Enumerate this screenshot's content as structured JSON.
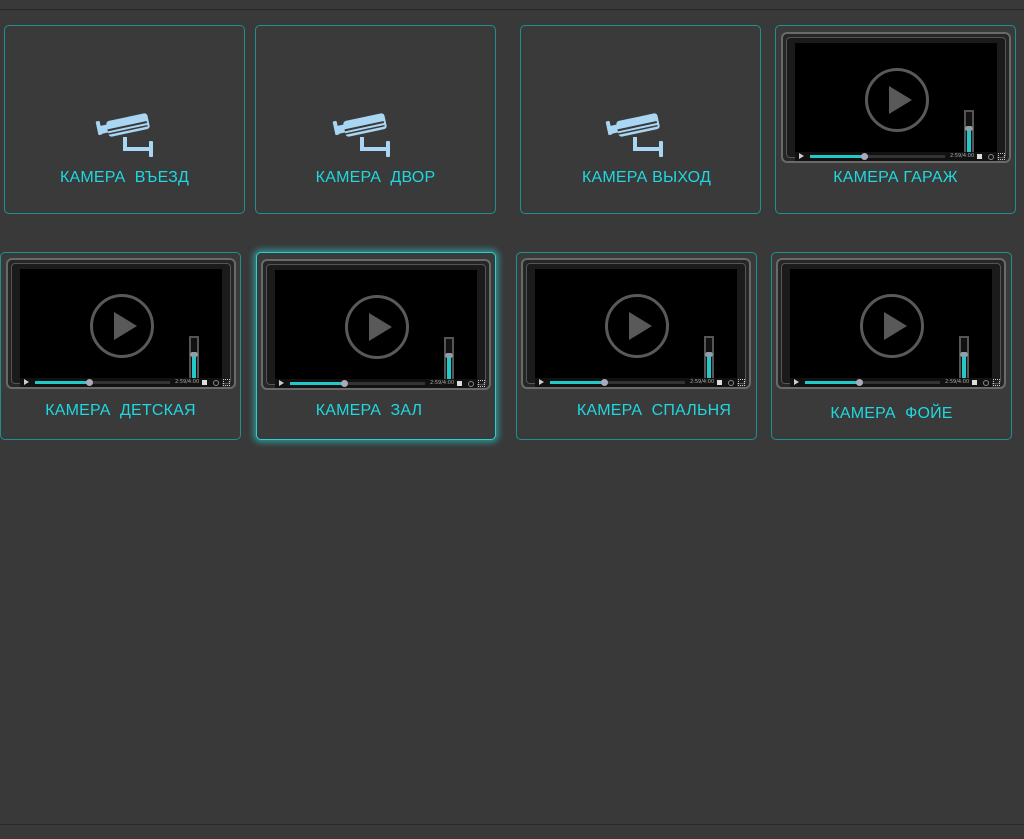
{
  "cameras": [
    {
      "label": "КАМЕРА  ВЪЕЗД",
      "view": "icon"
    },
    {
      "label": "КАМЕРА  ДВОР",
      "view": "icon"
    },
    {
      "label": "КАМЕРА ВЫХОД",
      "view": "icon"
    },
    {
      "label": "КАМЕРА ГАРАЖ",
      "view": "player"
    },
    {
      "label": "КАМЕРА  ДЕТСКАЯ",
      "view": "player"
    },
    {
      "label": "КАМЕРА  ЗАЛ",
      "view": "player",
      "selected": true
    },
    {
      "label": "КАМЕРА  СПАЛЬНЯ",
      "view": "player"
    },
    {
      "label": "КАМЕРА  ФОЙЕ",
      "view": "player"
    }
  ],
  "player": {
    "time_text": "2:59/4:00",
    "progress": 0.4,
    "volume": 0.62
  },
  "icons": {
    "camera": "security-camera-icon",
    "play": "play-icon"
  },
  "colors": {
    "background": "#393939",
    "tile_border": "#1f8f8f",
    "label": "#1fd8e0",
    "accent": "#22c9c9",
    "icon": "#a9d6f2"
  }
}
